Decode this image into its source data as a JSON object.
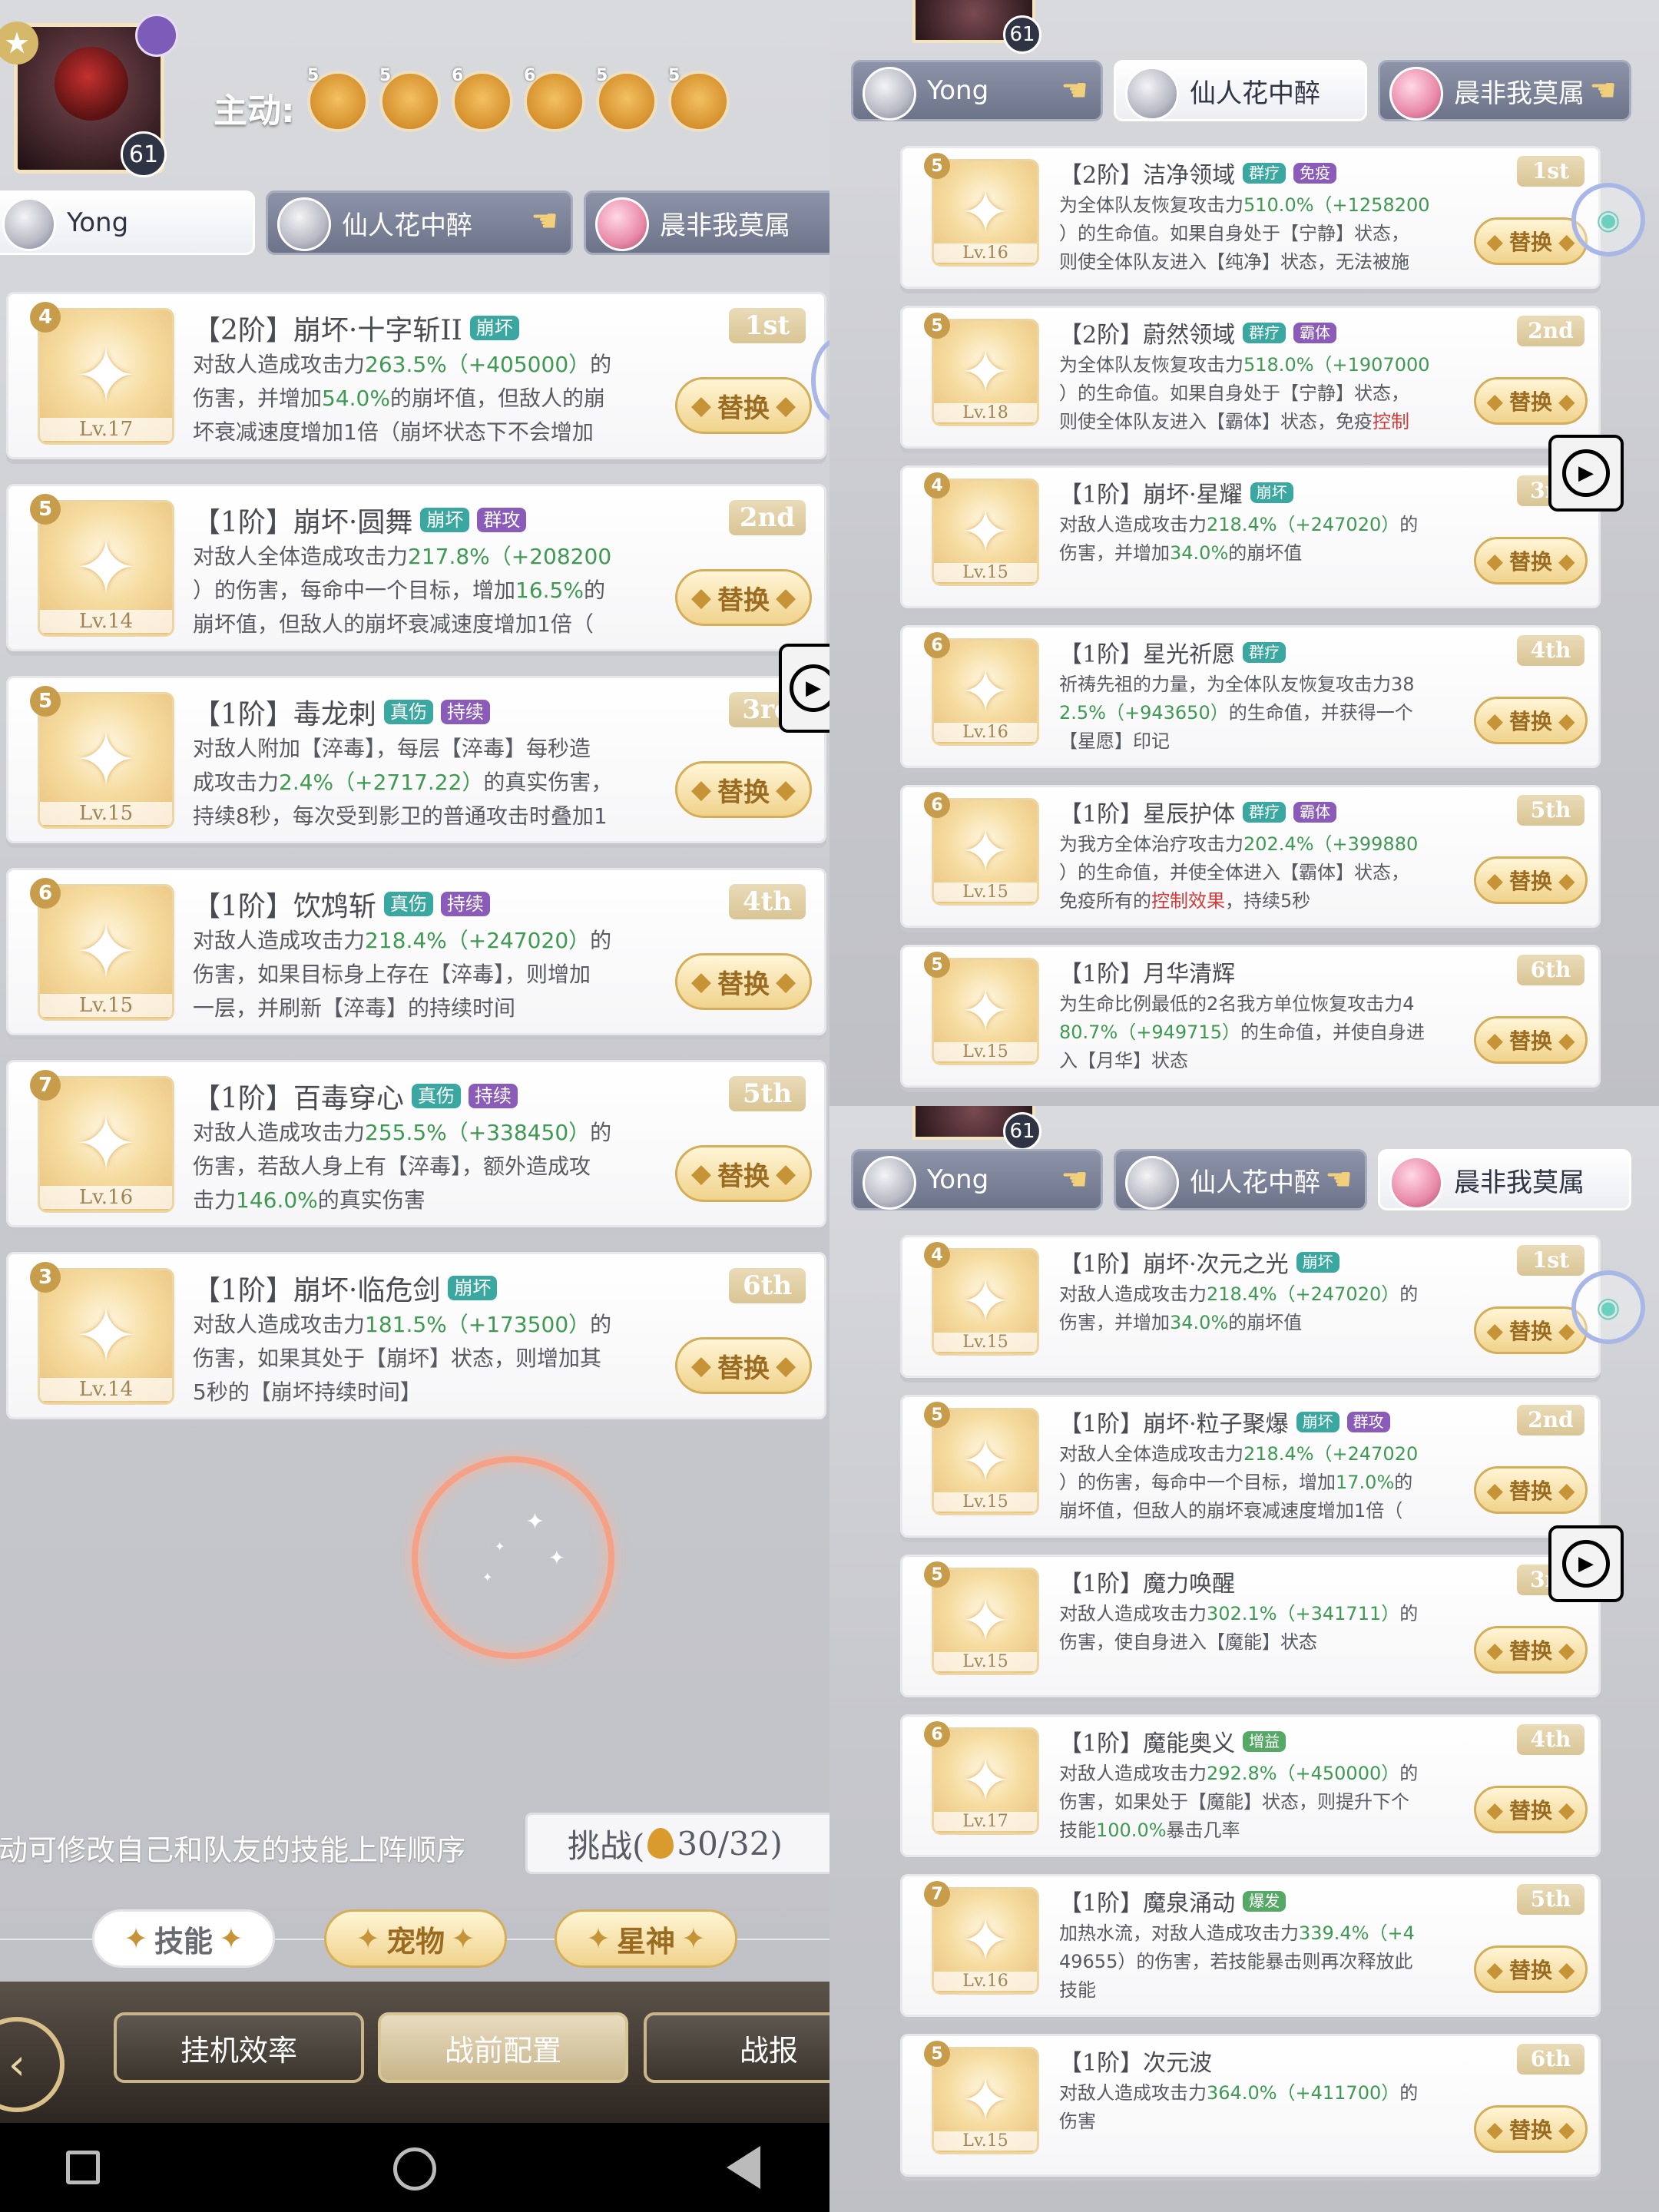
{
  "hero_level": "61",
  "active_label": "主动:",
  "active_slots": [
    "5",
    "5",
    "6",
    "6",
    "5",
    "5"
  ],
  "tabs": [
    {
      "name": "Yong"
    },
    {
      "name": "仙人花中醉"
    },
    {
      "name": "晨非我莫属"
    }
  ],
  "left_skills": [
    {
      "title": "【2阶】崩坏·十字斩II",
      "tags": [
        "崩坏"
      ],
      "rank": "1st",
      "stars": "4",
      "level": "Lv.17",
      "lines": [
        "对敌人造成攻击力263.5%（+405000）的",
        "伤害，并增加54.0%的崩坏值，但敌人的崩",
        "坏衰减速度增加1倍（崩坏状态下不会增加"
      ]
    },
    {
      "title": "【1阶】崩坏·圆舞",
      "tags": [
        "崩坏",
        "群攻"
      ],
      "rank": "2nd",
      "stars": "5",
      "level": "Lv.14",
      "lines": [
        "对敌人全体造成攻击力217.8%（+208200",
        "）的伤害，每命中一个目标，增加16.5%的",
        "崩坏值，但敌人的崩坏衰减速度增加1倍（"
      ]
    },
    {
      "title": "【1阶】毒龙刺",
      "tags": [
        "真伤",
        "持续"
      ],
      "rank": "3rd",
      "stars": "5",
      "level": "Lv.15",
      "lines": [
        "对敌人附加【淬毒】，每层【淬毒】每秒造",
        "成攻击力2.4%（+2717.22）的真实伤害，",
        "持续8秒，每次受到影卫的普通攻击时叠加1"
      ]
    },
    {
      "title": "【1阶】饮鸩斩",
      "tags": [
        "真伤",
        "持续"
      ],
      "rank": "4th",
      "stars": "6",
      "level": "Lv.15",
      "lines": [
        "对敌人造成攻击力218.4%（+247020）的",
        "伤害，如果目标身上存在【淬毒】，则增加",
        "一层，并刷新【淬毒】的持续时间"
      ]
    },
    {
      "title": "【1阶】百毒穿心",
      "tags": [
        "真伤",
        "持续"
      ],
      "rank": "5th",
      "stars": "7",
      "level": "Lv.16",
      "lines": [
        "对敌人造成攻击力255.5%（+338450）的",
        "伤害，若敌人身上有【淬毒】，额外造成攻",
        "击力146.0%的真实伤害"
      ]
    },
    {
      "title": "【1阶】崩坏·临危剑",
      "tags": [
        "崩坏"
      ],
      "rank": "6th",
      "stars": "3",
      "level": "Lv.14",
      "lines": [
        "对敌人造成攻击力181.5%（+173500）的",
        "伤害，如果其处于【崩坏】状态，则增加其",
        "5秒的【崩坏持续时间】"
      ]
    }
  ],
  "tr_skills": [
    {
      "title": "【2阶】洁净领域",
      "tags": [
        "群疗",
        "免疫"
      ],
      "rank": "1st",
      "stars": "5",
      "level": "Lv.16",
      "lines": [
        "为全体队友恢复攻击力510.0%（+1258200",
        "）的生命值。如果自身处于【宁静】状态，",
        "则使全体队友进入【纯净】状态，无法被施"
      ]
    },
    {
      "title": "【2阶】蔚然领域",
      "tags": [
        "群疗",
        "霸体"
      ],
      "rank": "2nd",
      "stars": "5",
      "level": "Lv.18",
      "lines": [
        "为全体队友恢复攻击力518.0%（+1907000",
        "）的生命值。如果自身处于【宁静】状态，",
        "则使全体队友进入【霸体】状态，免疫控制"
      ]
    },
    {
      "title": "【1阶】崩坏·星耀",
      "tags": [
        "崩坏"
      ],
      "rank": "3rd",
      "stars": "4",
      "level": "Lv.15",
      "lines": [
        "对敌人造成攻击力218.4%（+247020）的",
        "伤害，并增加34.0%的崩坏值"
      ]
    },
    {
      "title": "【1阶】星光祈愿",
      "tags": [
        "群疗"
      ],
      "rank": "4th",
      "stars": "6",
      "level": "Lv.16",
      "lines": [
        "祈祷先祖的力量，为全体队友恢复攻击力38",
        "2.5%（+943650）的生命值，并获得一个",
        "【星愿】印记"
      ]
    },
    {
      "title": "【1阶】星辰护体",
      "tags": [
        "群疗",
        "霸体"
      ],
      "rank": "5th",
      "stars": "6",
      "level": "Lv.15",
      "lines": [
        "为我方全体治疗攻击力202.4%（+399880",
        "）的生命值，并使全体进入【霸体】状态，",
        "免疫所有的控制效果，持续5秒"
      ]
    },
    {
      "title": "【1阶】月华清辉",
      "tags": [],
      "rank": "6th",
      "stars": "5",
      "level": "Lv.15",
      "lines": [
        "为生命比例最低的2名我方单位恢复攻击力4",
        "80.7%（+949715）的生命值，并使自身进",
        "入【月华】状态"
      ]
    }
  ],
  "br_skills": [
    {
      "title": "【1阶】崩坏·次元之光",
      "tags": [
        "崩坏"
      ],
      "rank": "1st",
      "stars": "4",
      "level": "Lv.15",
      "lines": [
        "对敌人造成攻击力218.4%（+247020）的",
        "伤害，并增加34.0%的崩坏值"
      ]
    },
    {
      "title": "【1阶】崩坏·粒子聚爆",
      "tags": [
        "崩坏",
        "群攻"
      ],
      "rank": "2nd",
      "stars": "5",
      "level": "Lv.15",
      "lines": [
        "对敌人全体造成攻击力218.4%（+247020",
        "）的伤害，每命中一个目标，增加17.0%的",
        "崩坏值，但敌人的崩坏衰减速度增加1倍（"
      ]
    },
    {
      "title": "【1阶】魔力唤醒",
      "tags": [],
      "rank": "3rd",
      "stars": "5",
      "level": "Lv.15",
      "lines": [
        "对敌人造成攻击力302.1%（+341711）的",
        "伤害，使自身进入【魔能】状态"
      ]
    },
    {
      "title": "【1阶】魔能奥义",
      "tags": [
        "增益"
      ],
      "rank": "4th",
      "stars": "6",
      "level": "Lv.17",
      "lines": [
        "对敌人造成攻击力292.8%（+450000）的",
        "伤害，如果处于【魔能】状态，则提升下个",
        "技能100.0%暴击几率"
      ]
    },
    {
      "title": "【1阶】魔泉涌动",
      "tags": [
        "爆发"
      ],
      "rank": "5th",
      "stars": "7",
      "level": "Lv.16",
      "lines": [
        "加热水流，对敌人造成攻击力339.4%（+4",
        "49655）的伤害，若技能暴击则再次释放此",
        "技能"
      ]
    },
    {
      "title": "【1阶】次元波",
      "tags": [],
      "rank": "6th",
      "stars": "5",
      "level": "Lv.15",
      "lines": [
        "对敌人造成攻击力364.0%（+411700）的",
        "伤害"
      ]
    }
  ],
  "swap_label": "替换",
  "hint": "拖动可修改自己和队友的技能上阵顺序",
  "challenge": {
    "label": "挑战(",
    "count": "30/32",
    "close": ")"
  },
  "bottom_tabs": [
    "技能",
    "宠物",
    "星神"
  ],
  "bottom_nav": [
    "挂机效率",
    "战前配置",
    "战报"
  ],
  "colors": {
    "tag_teal": "#3aa8a0",
    "tag_purple": "#8a5bb8",
    "rank_gold": "#d9c594",
    "accent_green": "#3e9a52",
    "accent_red": "#d33a3a"
  }
}
